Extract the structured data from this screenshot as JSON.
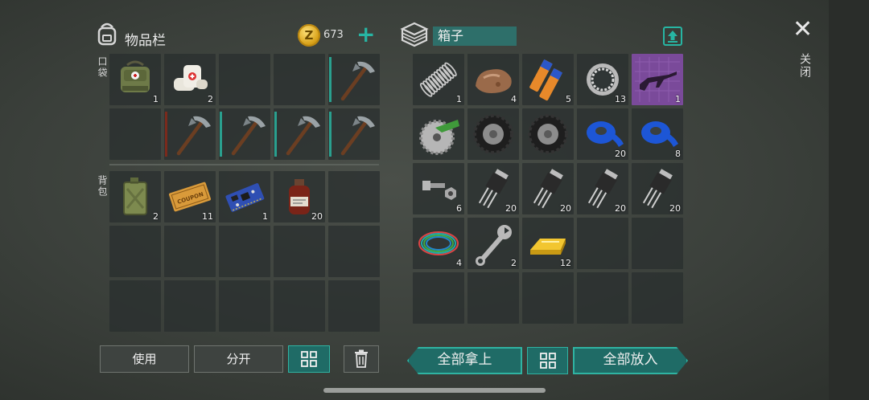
{
  "inventory": {
    "title": "物品栏",
    "coin_symbol": "Z",
    "coins": "673",
    "add_label": "+",
    "pocket_label": "口袋",
    "backpack_label": "背包",
    "pocket_slots": [
      {
        "item": "military-medkit-bag",
        "qty": "1"
      },
      {
        "item": "bandage",
        "qty": "2"
      },
      {
        "item": "empty",
        "qty": ""
      },
      {
        "item": "empty",
        "qty": ""
      },
      {
        "item": "pickaxe",
        "qty": "",
        "durability": "teal"
      },
      {
        "item": "empty",
        "qty": ""
      },
      {
        "item": "pickaxe",
        "qty": "",
        "durability": "red"
      },
      {
        "item": "pickaxe",
        "qty": "",
        "durability": "teal"
      },
      {
        "item": "pickaxe",
        "qty": "",
        "durability": "teal"
      },
      {
        "item": "pickaxe",
        "qty": "",
        "durability": "teal"
      }
    ],
    "backpack_slots": [
      {
        "item": "jerrycan",
        "qty": "2"
      },
      {
        "item": "coupon",
        "qty": "11"
      },
      {
        "item": "circuit-board",
        "qty": "1"
      },
      {
        "item": "medicine-bottle",
        "qty": "20"
      },
      {
        "item": "empty",
        "qty": ""
      },
      {
        "item": "empty",
        "qty": ""
      },
      {
        "item": "empty",
        "qty": ""
      },
      {
        "item": "empty",
        "qty": ""
      },
      {
        "item": "empty",
        "qty": ""
      },
      {
        "item": "empty",
        "qty": ""
      },
      {
        "item": "empty",
        "qty": ""
      },
      {
        "item": "empty",
        "qty": ""
      },
      {
        "item": "empty",
        "qty": ""
      },
      {
        "item": "empty",
        "qty": ""
      },
      {
        "item": "empty",
        "qty": ""
      }
    ],
    "coupon_text": "COUPON"
  },
  "box": {
    "name": "箱子",
    "slots": [
      {
        "item": "spring",
        "qty": "1"
      },
      {
        "item": "ore-rock",
        "qty": "4"
      },
      {
        "item": "batteries",
        "qty": "5"
      },
      {
        "item": "bearing",
        "qty": "13"
      },
      {
        "item": "ak-blueprint",
        "qty": "1"
      },
      {
        "item": "saw-blade",
        "qty": ""
      },
      {
        "item": "tire",
        "qty": ""
      },
      {
        "item": "tire",
        "qty": ""
      },
      {
        "item": "blue-tape",
        "qty": "20"
      },
      {
        "item": "blue-tape",
        "qty": "8"
      },
      {
        "item": "bolt-nut",
        "qty": "6"
      },
      {
        "item": "transistor",
        "qty": "20"
      },
      {
        "item": "transistor",
        "qty": "20"
      },
      {
        "item": "transistor",
        "qty": "20"
      },
      {
        "item": "transistor",
        "qty": "20"
      },
      {
        "item": "wire-coil",
        "qty": "4"
      },
      {
        "item": "wrench",
        "qty": "2"
      },
      {
        "item": "gold-bar",
        "qty": "12"
      },
      {
        "item": "empty",
        "qty": ""
      },
      {
        "item": "empty",
        "qty": ""
      },
      {
        "item": "empty",
        "qty": ""
      },
      {
        "item": "empty",
        "qty": ""
      },
      {
        "item": "empty",
        "qty": ""
      },
      {
        "item": "empty",
        "qty": ""
      },
      {
        "item": "empty",
        "qty": ""
      }
    ]
  },
  "actions": {
    "use": "使用",
    "split": "分开",
    "take_all": "全部拿上",
    "put_all": "全部放入"
  },
  "close": {
    "icon": "✕",
    "label": "关闭"
  },
  "colors": {
    "accent": "#27b5a3",
    "button_teal": "#1f6b66",
    "slot_bg": "#2f3535"
  }
}
